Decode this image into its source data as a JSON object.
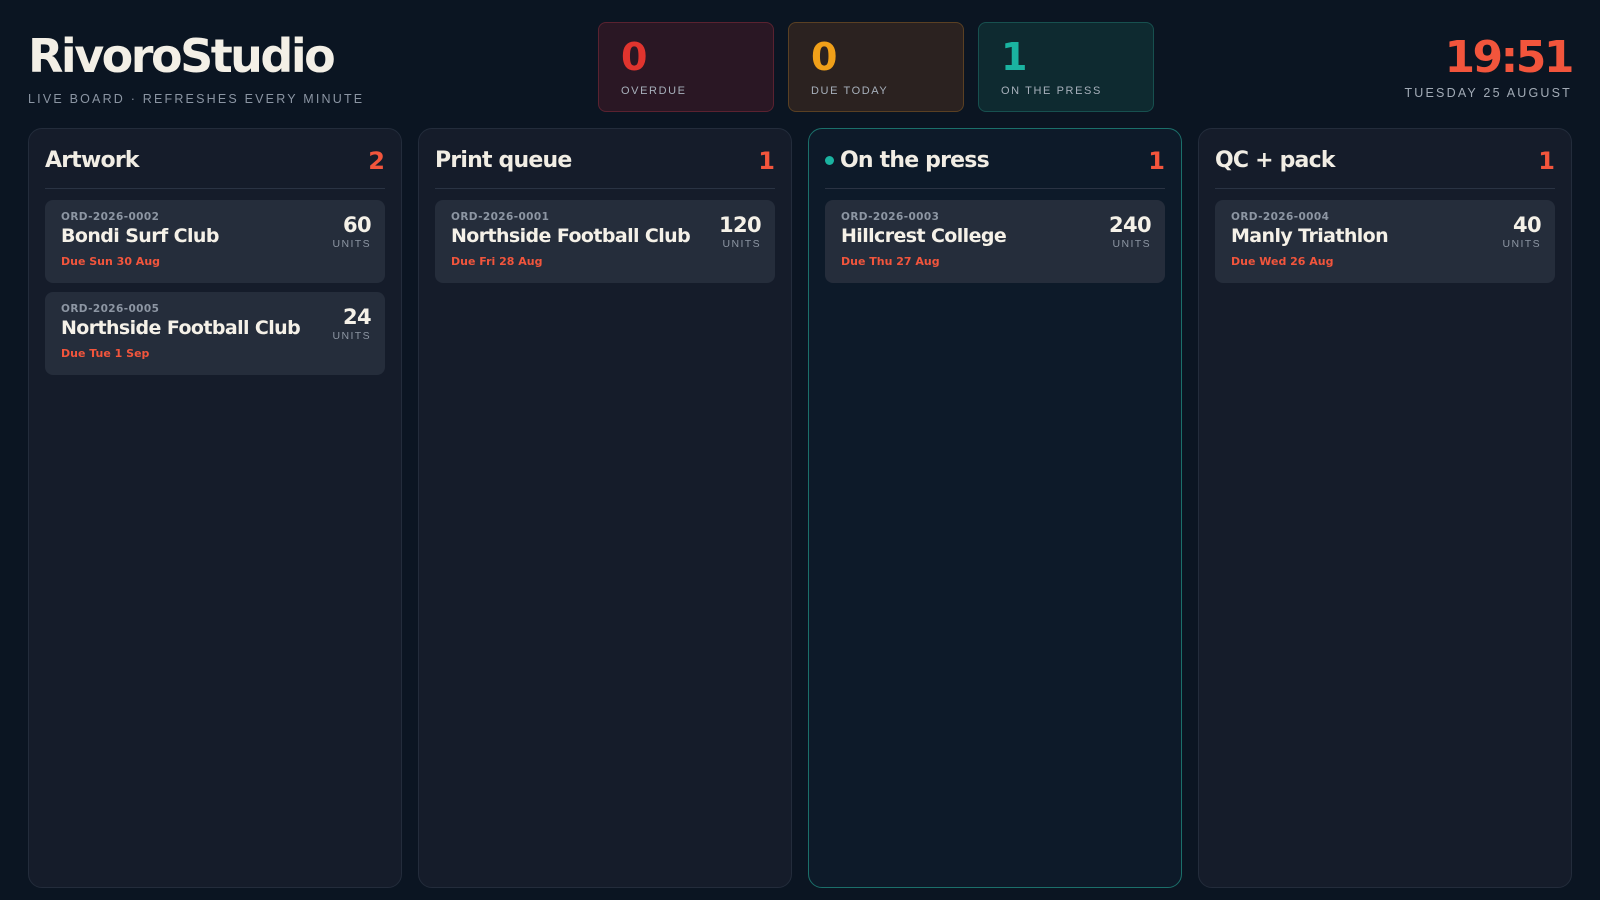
{
  "header": {
    "brand": "RivoroStudio",
    "subtitle": "LIVE BOARD · REFRESHES EVERY MINUTE",
    "time": "19:51",
    "date": "TUESDAY 25 AUGUST"
  },
  "stats": {
    "overdue": {
      "value": "0",
      "label": "OVERDUE",
      "color": "#e0342e"
    },
    "due_today": {
      "value": "0",
      "label": "DUE TODAY",
      "color": "#f0a019"
    },
    "on_press": {
      "value": "1",
      "label": "ON THE PRESS",
      "color": "#1ab3a0"
    }
  },
  "columns": [
    {
      "title": "Artwork",
      "count": "2",
      "cards": [
        {
          "id": "ORD-2026-0002",
          "name": "Bondi Surf Club",
          "due": "Due Sun 30 Aug",
          "qty": "60",
          "unit": "UNITS"
        },
        {
          "id": "ORD-2026-0005",
          "name": "Northside Football Club",
          "due": "Due Tue 1 Sep",
          "qty": "24",
          "unit": "UNITS"
        }
      ]
    },
    {
      "title": "Print queue",
      "count": "1",
      "cards": [
        {
          "id": "ORD-2026-0001",
          "name": "Northside Football Club",
          "due": "Due Fri 28 Aug",
          "qty": "120",
          "unit": "UNITS"
        }
      ]
    },
    {
      "title": "On the press",
      "count": "1",
      "active": true,
      "cards": [
        {
          "id": "ORD-2026-0003",
          "name": "Hillcrest College",
          "due": "Due Thu 27 Aug",
          "qty": "240",
          "unit": "UNITS"
        }
      ]
    },
    {
      "title": "QC + pack",
      "count": "1",
      "cards": [
        {
          "id": "ORD-2026-0004",
          "name": "Manly Triathlon",
          "due": "Due Wed 26 Aug",
          "qty": "40",
          "unit": "UNITS"
        }
      ]
    }
  ],
  "colors": {
    "accent": "#f2553c",
    "teal": "#1ab3a0",
    "background": "#0b1522"
  }
}
